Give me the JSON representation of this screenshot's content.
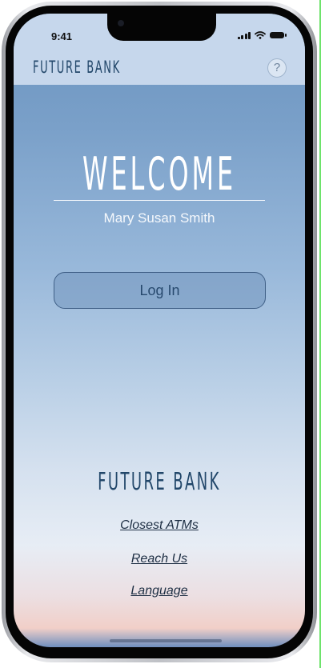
{
  "status_bar": {
    "time": "9:41",
    "icons": [
      "signal-icon",
      "wifi-icon",
      "battery-icon"
    ]
  },
  "header": {
    "brand": "FUTURE BANK",
    "help_label": "?"
  },
  "welcome": {
    "title": "WELCOME",
    "user_name": "Mary Susan Smith"
  },
  "actions": {
    "login_label": "Log In"
  },
  "footer": {
    "brand": "FUTURE BANK",
    "links": [
      "Closest ATMs",
      "Reach Us",
      "Language"
    ]
  },
  "colors": {
    "brand_navy": "#22476a",
    "top_bar": "#c6d7ec",
    "gradient_top": "#6a93bf",
    "gradient_bottom": "#f1cfc8"
  }
}
